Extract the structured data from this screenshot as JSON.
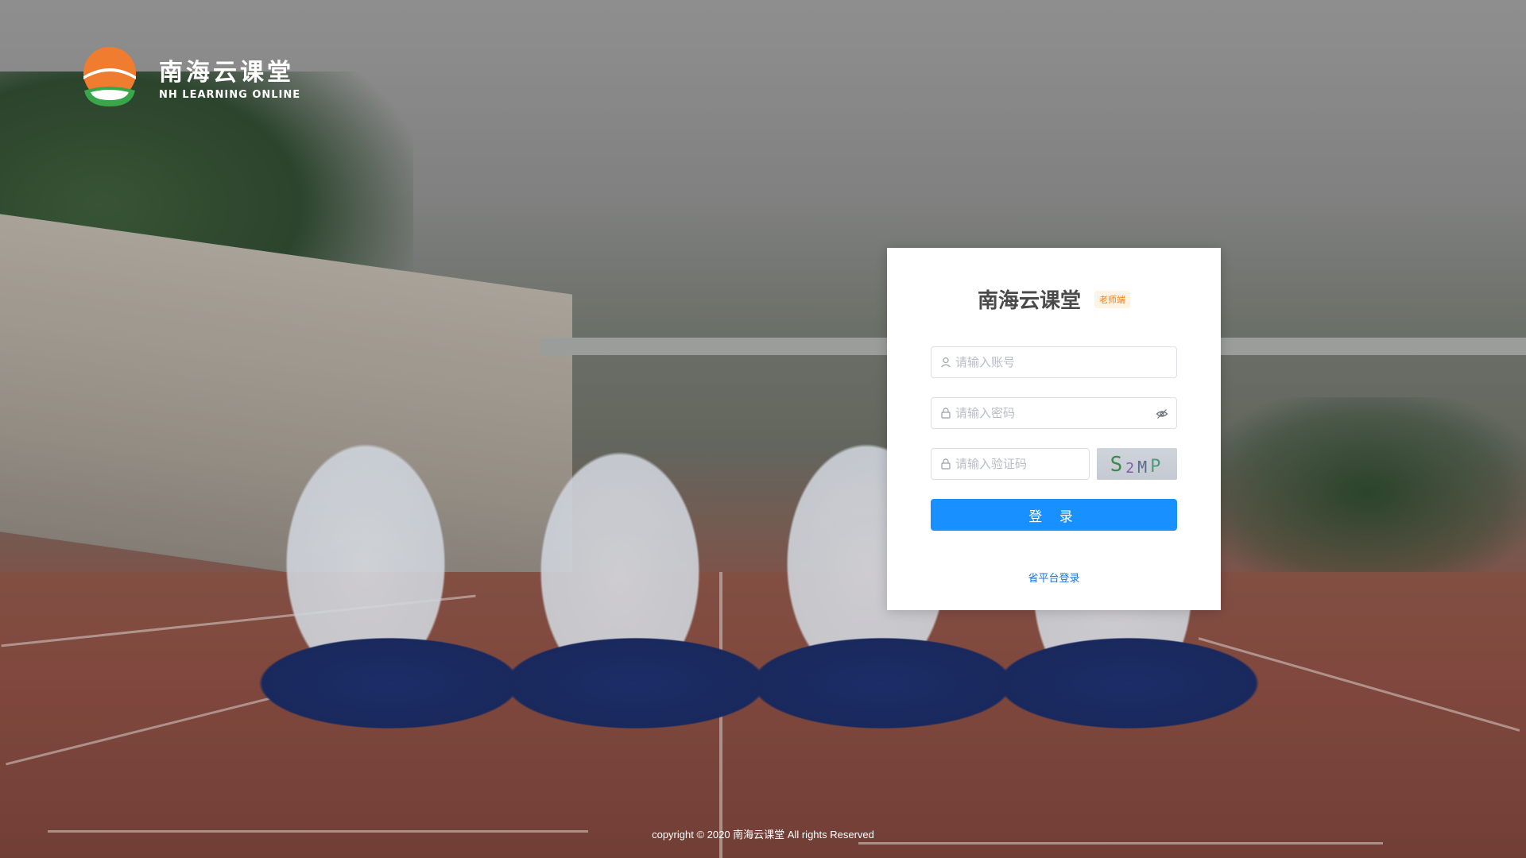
{
  "brand": {
    "title": "南海云课堂",
    "subtitle": "NH LEARNING ONLINE"
  },
  "login": {
    "app_name": "南海云课堂",
    "role_badge": "老师端",
    "account_placeholder": "请输入账号",
    "password_placeholder": "请输入密码",
    "captcha_placeholder": "请输入验证码",
    "captcha_chars": [
      "S",
      "2",
      "M",
      "P"
    ],
    "login_label": "登 录",
    "platform_link": "省平台登录"
  },
  "footer": {
    "text": "copyright © 2020 南海云课堂 All rights Reserved"
  },
  "colors": {
    "primary": "#1890ff",
    "badge_text": "#f07f1b",
    "badge_bg": "#fff3e3",
    "link": "#1a73d9",
    "logo_orange": "#f07c30",
    "logo_green": "#3aa64a"
  },
  "icons": {
    "account": "user-icon",
    "password": "lock-icon",
    "captcha": "lock-icon",
    "visibility": "eye-hidden-icon"
  }
}
